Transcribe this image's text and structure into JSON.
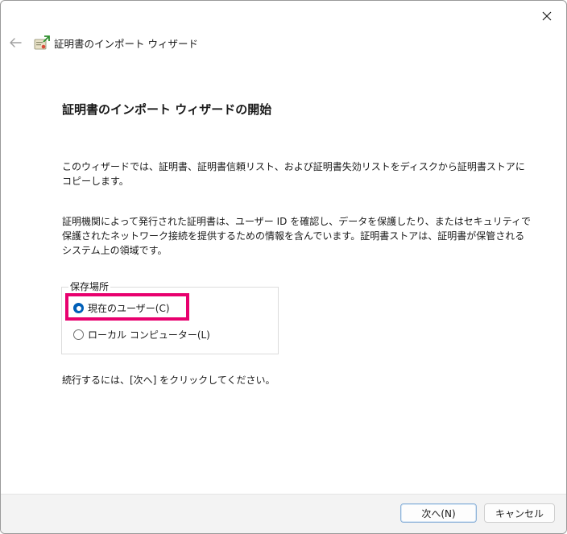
{
  "window": {
    "title": "証明書のインポート ウィザード"
  },
  "wizard": {
    "heading": "証明書のインポート ウィザードの開始",
    "intro": "このウィザードでは、証明書、証明書信頼リスト、および証明書失効リストをディスクから証明書ストアにコピーします。",
    "description": "証明機関によって発行された証明書は、ユーザー ID を確認し、データを保護したり、またはセキュリティで保護されたネットワーク接続を提供するための情報を含んでいます。証明書ストアは、証明書が保管されるシステム上の領域です。",
    "store_location": {
      "label": "保存場所",
      "options": [
        {
          "label": "現在のユーザー(C)",
          "checked": true
        },
        {
          "label": "ローカル コンピューター(L)",
          "checked": false
        }
      ]
    },
    "continue_text": "続行するには、[次へ] をクリックしてください。"
  },
  "footer": {
    "next_label": "次へ(N)",
    "cancel_label": "キャンセル"
  },
  "colors": {
    "highlight": "#e8006e",
    "radio_accent": "#005fb8"
  },
  "icons": {
    "close": "close-icon",
    "back": "back-arrow-icon",
    "wizard": "certificate-wizard-icon"
  }
}
